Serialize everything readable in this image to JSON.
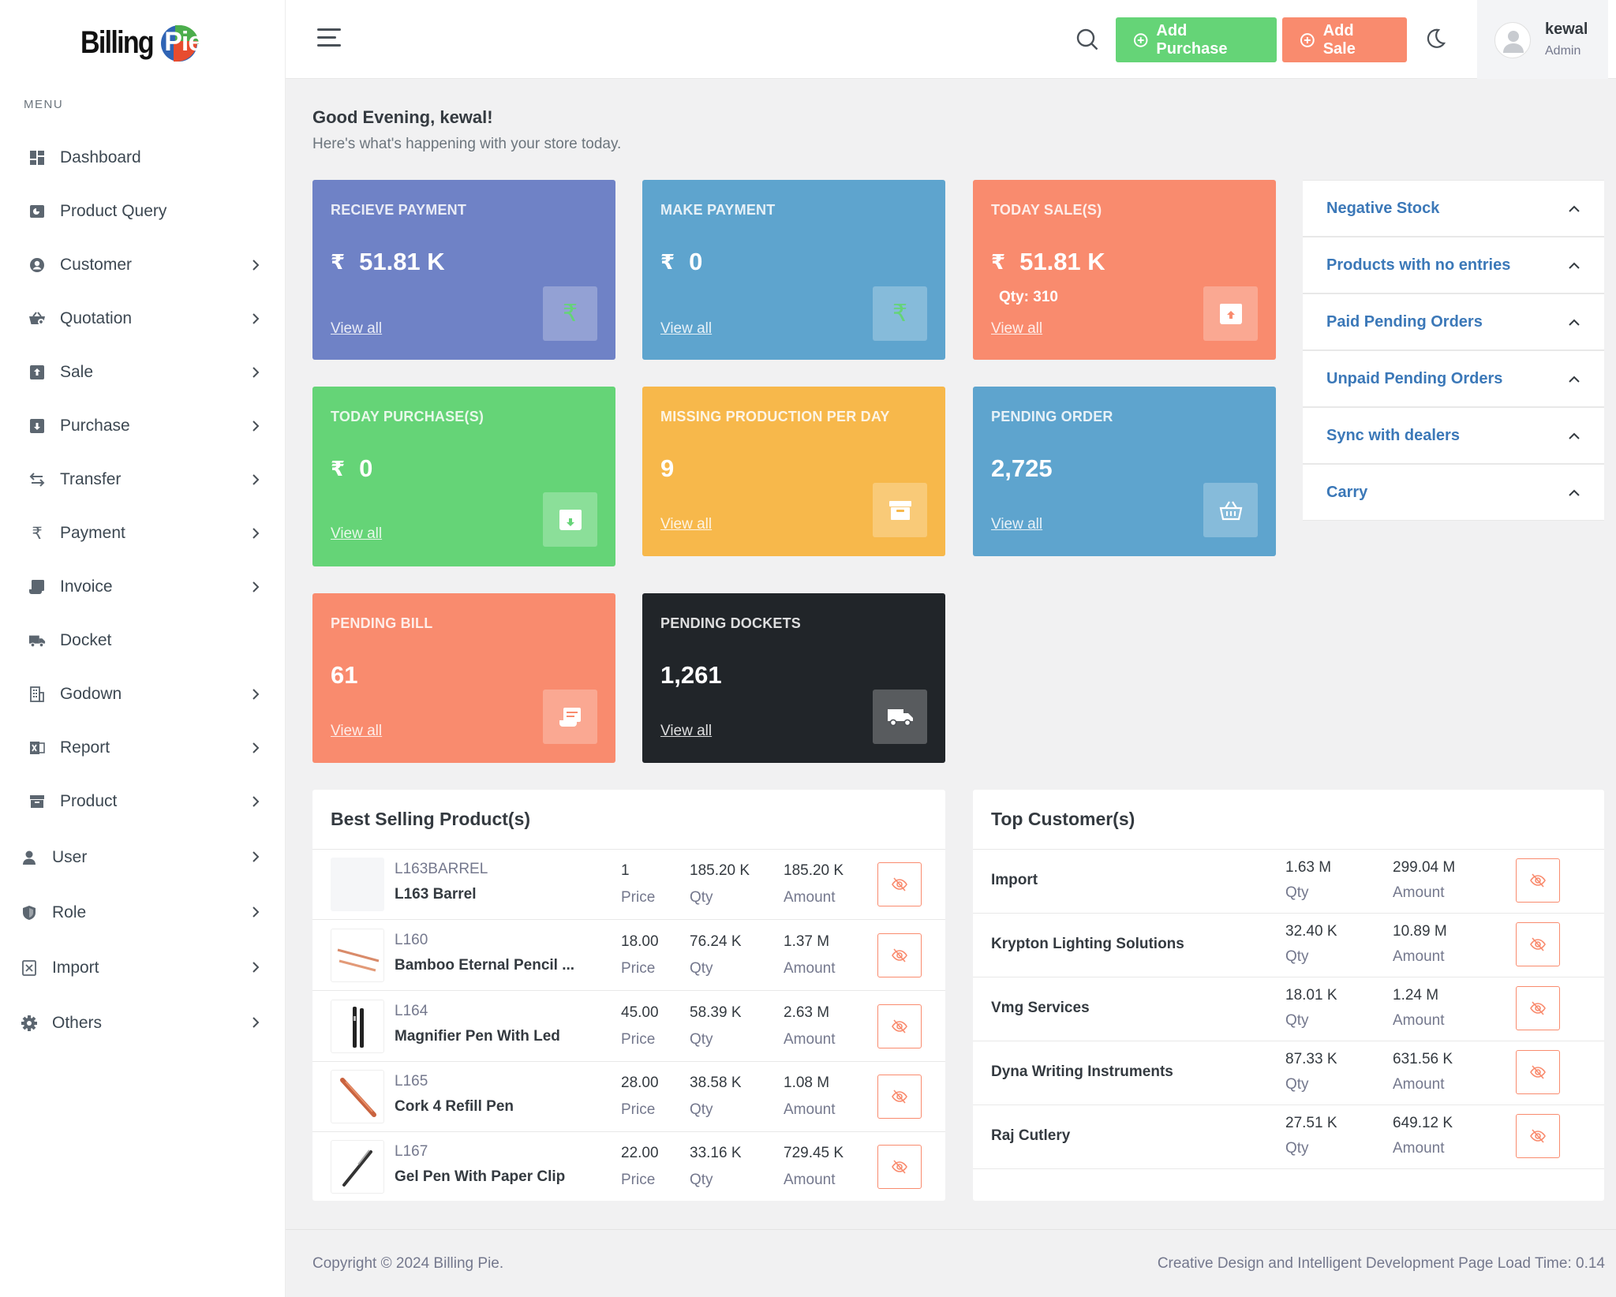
{
  "brand": {
    "name_part1": "Billing",
    "name_part2": "Pie"
  },
  "sidebar": {
    "menu_title": "MENU",
    "items": [
      {
        "label": "Dashboard",
        "icon": "dashboard-icon",
        "has_children": false
      },
      {
        "label": "Product Query",
        "icon": "product-query-icon",
        "has_children": false
      },
      {
        "label": "Customer",
        "icon": "user-circle-icon",
        "has_children": true
      },
      {
        "label": "Quotation",
        "icon": "basket-icon",
        "has_children": true
      },
      {
        "label": "Sale",
        "icon": "box-upload-icon",
        "has_children": true
      },
      {
        "label": "Purchase",
        "icon": "box-download-icon",
        "has_children": true
      },
      {
        "label": "Transfer",
        "icon": "transfer-arrows-icon",
        "has_children": true
      },
      {
        "label": "Payment",
        "icon": "rupee-icon",
        "has_children": true
      },
      {
        "label": "Invoice",
        "icon": "invoice-icon",
        "has_children": true
      },
      {
        "label": "Docket",
        "icon": "truck-icon",
        "has_children": false
      },
      {
        "label": "Godown",
        "icon": "building-icon",
        "has_children": true
      },
      {
        "label": "Report",
        "icon": "excel-icon",
        "has_children": true
      },
      {
        "label": "Product",
        "icon": "archive-icon",
        "has_children": true
      }
    ],
    "items2": [
      {
        "label": "User",
        "icon": "user-icon",
        "has_children": true
      },
      {
        "label": "Role",
        "icon": "shield-icon",
        "has_children": true
      },
      {
        "label": "Import",
        "icon": "import-file-icon",
        "has_children": true
      },
      {
        "label": "Others",
        "icon": "gear-icon",
        "has_children": true
      }
    ]
  },
  "topbar": {
    "add_purchase": "Add Purchase",
    "add_sale": "Add Sale",
    "user_name": "kewal",
    "user_role": "Admin"
  },
  "greeting": {
    "title": "Good Evening, kewal!",
    "subtitle": "Here's what's happening with your store today."
  },
  "cards": [
    {
      "title": "RECIEVE PAYMENT",
      "currency": "₹",
      "value": "51.81 K",
      "link": "View all",
      "color": "#6f82c6"
    },
    {
      "title": "MAKE PAYMENT",
      "currency": "₹",
      "value": "0",
      "link": "View all",
      "color": "#5ea4ce"
    },
    {
      "title": "TODAY SALE(S)",
      "currency": "₹",
      "value": "51.81 K",
      "sub": "Qty: 310",
      "link": "View all",
      "color": "#f98b6e"
    },
    {
      "title": "TODAY PURCHASE(S)",
      "currency": "₹",
      "value": "0",
      "link": "View all",
      "color": "#65d477"
    },
    {
      "title": "MISSING PRODUCTION PER DAY",
      "value": "9",
      "link": "View all",
      "color": "#f7b84b"
    },
    {
      "title": "PENDING ORDER",
      "value": "2,725",
      "link": "View all",
      "color": "#5ea4ce"
    },
    {
      "title": "PENDING BILL",
      "value": "61",
      "link": "View all",
      "color": "#f98b6e"
    },
    {
      "title": "PENDING DOCKETS",
      "value": "1,261",
      "link": "View all",
      "color": "#212529"
    }
  ],
  "accordion": [
    "Negative Stock",
    "Products with no entries",
    "Paid Pending Orders",
    "Unpaid Pending Orders",
    "Sync with dealers",
    "Carry"
  ],
  "best_selling": {
    "title": "Best Selling Product(s)",
    "labels": {
      "price": "Price",
      "qty": "Qty",
      "amount": "Amount"
    },
    "rows": [
      {
        "code": "L163BARREL",
        "name": "L163 Barrel",
        "price": "1",
        "qty": "185.20 K",
        "amount": "185.20 K"
      },
      {
        "code": "L160",
        "name": "Bamboo Eternal Pencil ...",
        "price": "18.00",
        "qty": "76.24 K",
        "amount": "1.37 M"
      },
      {
        "code": "L164",
        "name": "Magnifier Pen With Led",
        "price": "45.00",
        "qty": "58.39 K",
        "amount": "2.63 M"
      },
      {
        "code": "L165",
        "name": "Cork 4 Refill Pen",
        "price": "28.00",
        "qty": "38.58 K",
        "amount": "1.08 M"
      },
      {
        "code": "L167",
        "name": "Gel Pen With Paper Clip",
        "price": "22.00",
        "qty": "33.16 K",
        "amount": "729.45 K"
      }
    ]
  },
  "top_customers": {
    "title": "Top Customer(s)",
    "labels": {
      "qty": "Qty",
      "amount": "Amount"
    },
    "rows": [
      {
        "name": "Import",
        "qty": "1.63 M",
        "amount": "299.04 M"
      },
      {
        "name": "Krypton Lighting Solutions",
        "qty": "32.40 K",
        "amount": "10.89 M"
      },
      {
        "name": "Vmg Services",
        "qty": "18.01 K",
        "amount": "1.24 M"
      },
      {
        "name": "Dyna Writing Instruments",
        "qty": "87.33 K",
        "amount": "631.56 K"
      },
      {
        "name": "Raj Cutlery",
        "qty": "27.51 K",
        "amount": "649.12 K"
      }
    ]
  },
  "footer": {
    "left": "Copyright © 2024 Billing Pie.",
    "right": "Creative Design and Intelligent Development Page Load Time: 0.14"
  }
}
